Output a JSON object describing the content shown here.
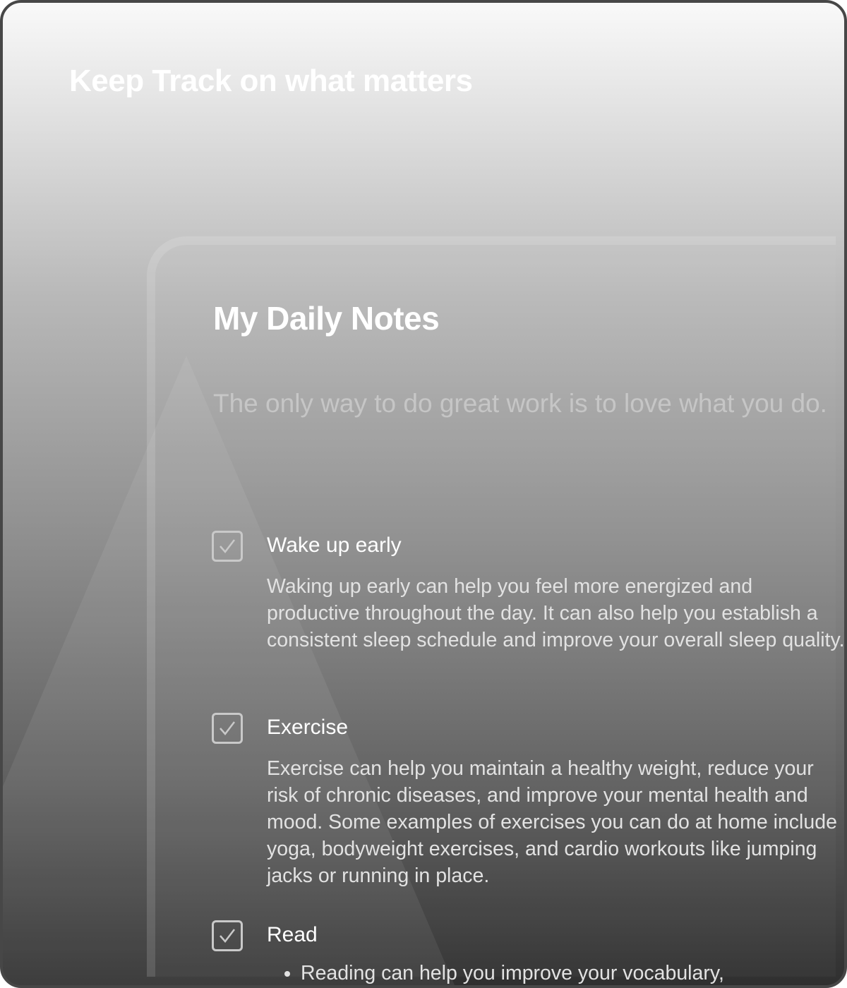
{
  "hero": {
    "title": "Keep Track on what matters"
  },
  "notes": {
    "title": "My Daily Notes",
    "quote": "The only way to do great work is to love what you do.",
    "items": [
      {
        "label": "Wake up early",
        "checked": true,
        "description": "Waking up early can help you feel more energized and productive throughout the day. It can also help you establish a consistent sleep schedule and improve your overall sleep quality."
      },
      {
        "label": "Exercise",
        "checked": true,
        "description": "Exercise can help you maintain a healthy weight, reduce your risk of chronic diseases, and improve your mental health and mood. Some examples of exercises you can do at home include yoga, bodyweight exercises, and cardio workouts like jumping jacks or running in place."
      },
      {
        "label": "Read",
        "checked": true,
        "bullets": [
          "Reading can help you improve your vocabulary,"
        ]
      }
    ]
  }
}
